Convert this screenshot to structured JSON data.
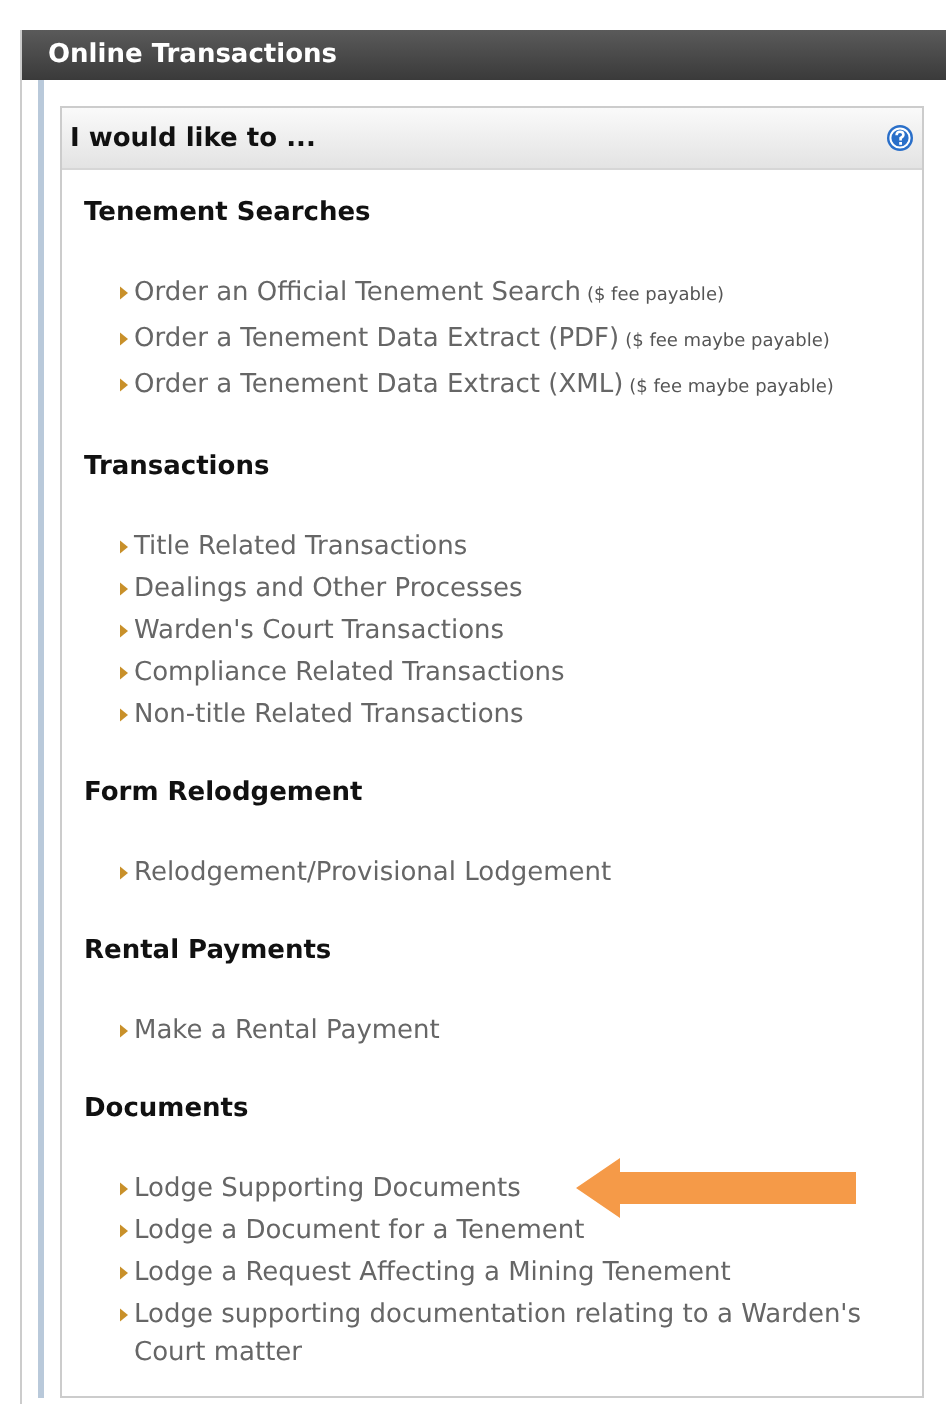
{
  "panel": {
    "title": "Online Transactions"
  },
  "box": {
    "title": "I would like to ...",
    "help_icon": true
  },
  "sections": [
    {
      "heading": "Tenement Searches",
      "links": [
        {
          "text": "Order an Official Tenement Search",
          "note": "($ fee payable)"
        },
        {
          "text": "Order a Tenement Data Extract (PDF)",
          "note": "($ fee maybe payable)"
        },
        {
          "text": "Order a Tenement Data Extract (XML)",
          "note": "($ fee maybe payable)"
        }
      ]
    },
    {
      "heading": "Transactions",
      "links": [
        {
          "text": "Title Related Transactions"
        },
        {
          "text": "Dealings and Other Processes"
        },
        {
          "text": "Warden's Court Transactions"
        },
        {
          "text": "Compliance Related Transactions"
        },
        {
          "text": "Non-title Related Transactions"
        }
      ]
    },
    {
      "heading": "Form Relodgement",
      "links": [
        {
          "text": "Relodgement/Provisional Lodgement"
        }
      ]
    },
    {
      "heading": "Rental Payments",
      "links": [
        {
          "text": "Make a Rental Payment"
        }
      ]
    },
    {
      "heading": "Documents",
      "links": [
        {
          "text": "Lodge Supporting Documents",
          "pointed": true
        },
        {
          "text": "Lodge a Document for a Tenement"
        },
        {
          "text": "Lodge a Request Affecting a Mining Tenement"
        },
        {
          "text": "Lodge supporting documentation relating to a Warden's Court matter"
        }
      ]
    }
  ]
}
